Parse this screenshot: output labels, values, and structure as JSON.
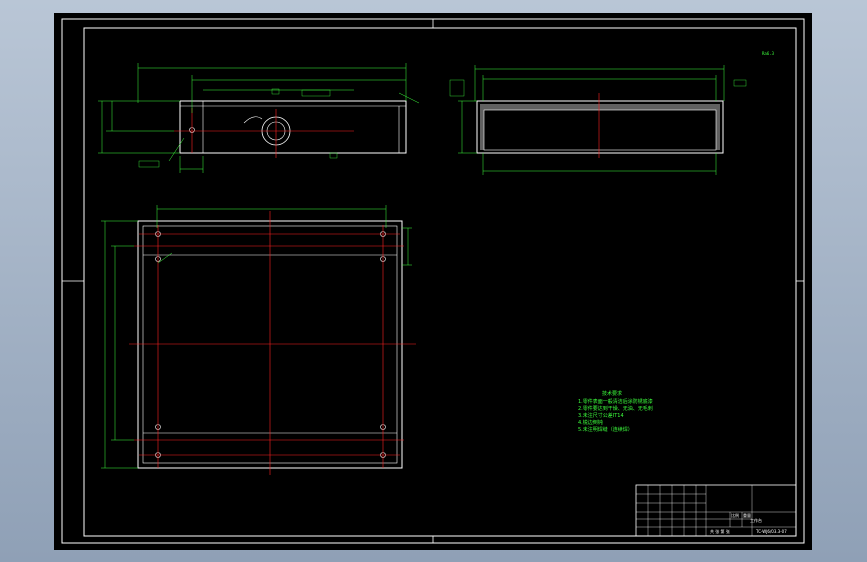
{
  "drawing": {
    "roughness_mark": "Ra6.3",
    "notes_title": "技术要求",
    "notes": [
      "1.零件表面一般清洁后涂防锈底漆",
      "2.零件要达到干燥、无油、无毛刺",
      "3.未注尺寸公差IT14",
      "4.锐边倒钝",
      "5.未注明焊缝（连续焊）"
    ],
    "title_block": {
      "part_name": "工作台",
      "drawing_number": "TC-WJ6/03.3-07",
      "scale_header": "比例",
      "weight_header": "重量",
      "sheet_info": "共 张 第 张"
    }
  },
  "colors": {
    "background": "#000000",
    "outline": "#ffffff",
    "dimension": "#3cff3c",
    "centerline": "#ff2020",
    "hatch": "#a0a0a0"
  }
}
